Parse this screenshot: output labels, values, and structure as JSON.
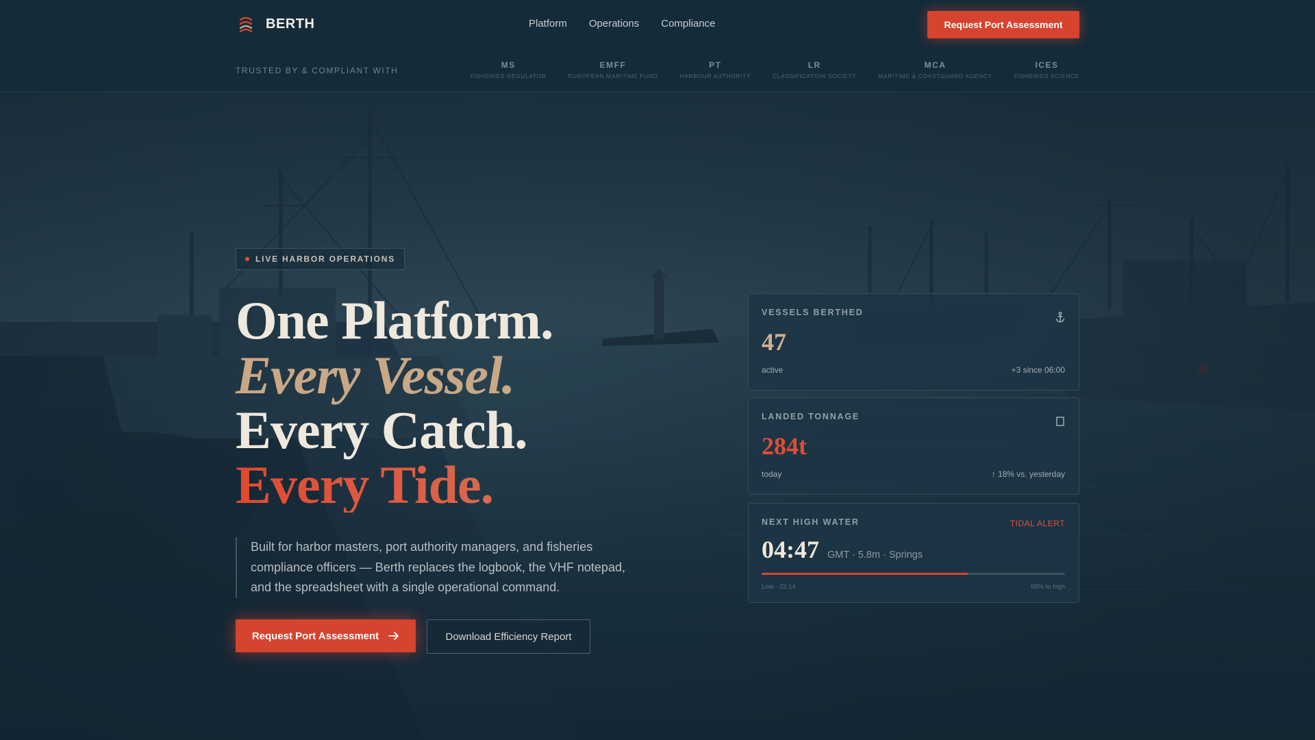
{
  "brand": {
    "name": "BERTH"
  },
  "nav": {
    "links": [
      "Platform",
      "Operations",
      "Compliance"
    ],
    "cta_label": "Request Port Assessment"
  },
  "trust": {
    "label": "TRUSTED BY & COMPLIANT WITH",
    "items": [
      {
        "abbr": "MS",
        "full": "Fisheries Regulator"
      },
      {
        "abbr": "EMFF",
        "full": "European Maritime Fund"
      },
      {
        "abbr": "PT",
        "full": "Harbour Authority"
      },
      {
        "abbr": "LR",
        "full": "Classification Society"
      },
      {
        "abbr": "MCA",
        "full": "Maritime & Coastguard Agency"
      },
      {
        "abbr": "ICES",
        "full": "Fisheries Science"
      }
    ]
  },
  "hero": {
    "badge": "LIVE HARBOR OPERATIONS",
    "headline": [
      "One Platform.",
      "Every Vessel.",
      "Every Catch.",
      "Every Tide."
    ],
    "lede": "Built for harbor masters, port authority managers, and fisheries compliance officers — Berth replaces the logbook, the VHF notepad, and the spreadsheet with a single operational command.",
    "primary_cta": "Request Port Assessment",
    "secondary_cta": "Download Efficiency Report"
  },
  "cards": {
    "vessels": {
      "label": "VESSELS BERTHED",
      "value": "47",
      "sub": "active",
      "delta": "+3 since 06:00",
      "icon": "anchor-icon"
    },
    "tonnage": {
      "label": "LANDED TONNAGE",
      "value": "284t",
      "sub": "today",
      "delta": "↑ 18% vs. yesterday",
      "icon": "crate-icon"
    },
    "tide": {
      "label": "NEXT HIGH WATER",
      "alert": "TIDAL ALERT",
      "time": "04:47",
      "meta": "GMT · 5.8m · Springs",
      "progress": 0.68,
      "low": "Low · 22:14",
      "to_high": "68% to high"
    }
  },
  "colors": {
    "accent": "#d6432f",
    "tan": "#c9a886",
    "navy": "#142b39"
  }
}
